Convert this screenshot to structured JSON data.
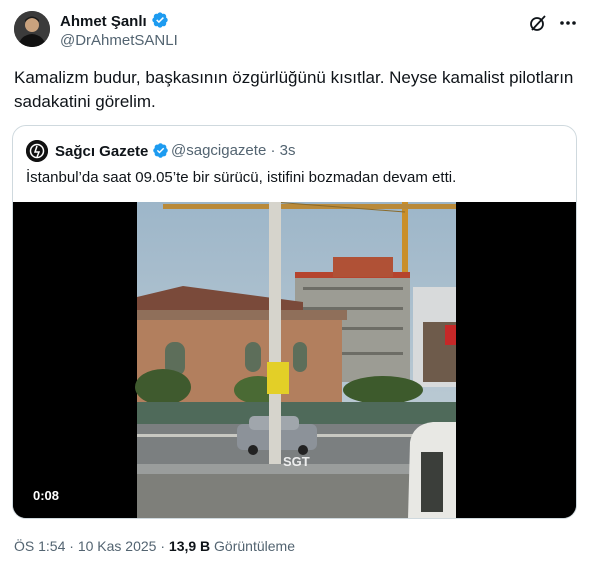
{
  "author": {
    "name": "Ahmet Şanlı",
    "handle": "@DrAhmetSANLI",
    "verified": true,
    "avatar_icon": "user-avatar"
  },
  "tweet": {
    "text": "Kamalizm budur, başkasının özgürlüğünü kısıtlar. Neyse kamalist pilotların sadakatini görelim."
  },
  "quoted": {
    "name": "Sağcı Gazete",
    "handle": "@sagcigazete",
    "time": "3s",
    "text": "İstanbul’da saat 09.05’te bir sürücü, istifini bozmadan devam etti.",
    "video": {
      "duration": "0:08",
      "watermark": "SGT"
    }
  },
  "meta": {
    "time": "ÖS 1:54",
    "date": "10 Kas 2025",
    "views_count": "13,9 B",
    "views_label": "Görüntüleme"
  },
  "colors": {
    "verified": "#1d9bf0",
    "secondary_text": "#536471",
    "border": "#cfd9de"
  },
  "icons": {
    "grok": "grok-icon",
    "more": "more-icon"
  }
}
